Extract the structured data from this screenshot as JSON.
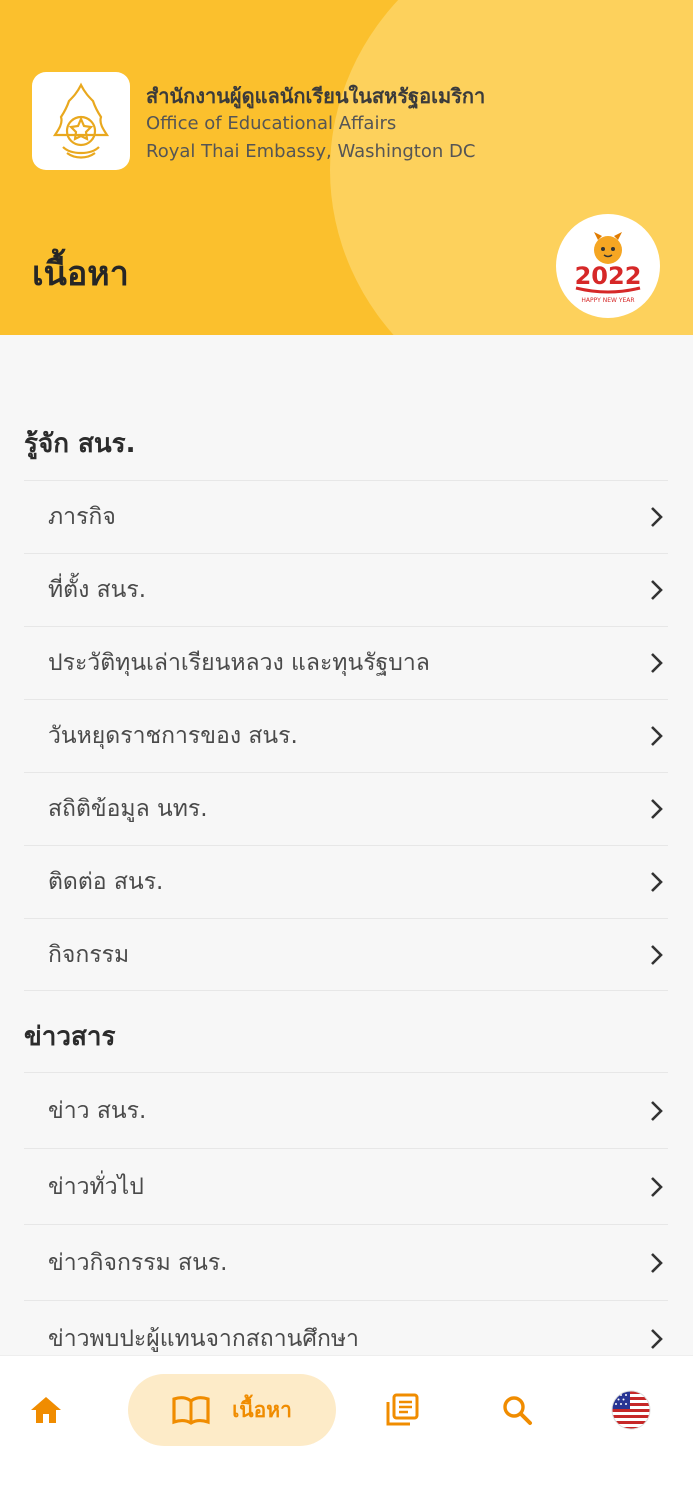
{
  "header": {
    "org_name_th": "สำนักงานผู้ดูแลนักเรียนในสหรัฐอเมริกา",
    "org_name_en_1": "Office of Educational Affairs",
    "org_name_en_2": "Royal Thai Embassy, Washington DC",
    "page_title": "เนื้อหา",
    "badge_year_text": "2022",
    "badge_caption": "HAPPY NEW YEAR"
  },
  "sections": [
    {
      "title": "รู้จัก สนร.",
      "items": [
        {
          "label": "ภารกิจ"
        },
        {
          "label": "ที่ตั้ง สนร."
        },
        {
          "label": "ประวัติทุนเล่าเรียนหลวง และทุนรัฐบาล"
        },
        {
          "label": "วันหยุดราชการของ สนร."
        },
        {
          "label": "สถิติข้อมูล นทร."
        },
        {
          "label": "ติดต่อ สนร."
        },
        {
          "label": "กิจกรรม"
        }
      ]
    },
    {
      "title": "ข่าวสาร",
      "items": [
        {
          "label": "ข่าว สนร."
        },
        {
          "label": "ข่าวทั่วไป"
        },
        {
          "label": "ข่าวกิจกรรม สนร."
        },
        {
          "label": "ข่าวพบปะผู้แทนจากสถานศึกษา"
        }
      ]
    }
  ],
  "bottom_nav": {
    "active_label": "เนื้อหา",
    "items": [
      "home-icon",
      "book-icon",
      "library-icon",
      "search-icon",
      "us-flag-icon"
    ]
  },
  "colors": {
    "header_bg": "#fbc02d",
    "accent": "#f08c00",
    "pill_bg": "#fdebc8"
  }
}
